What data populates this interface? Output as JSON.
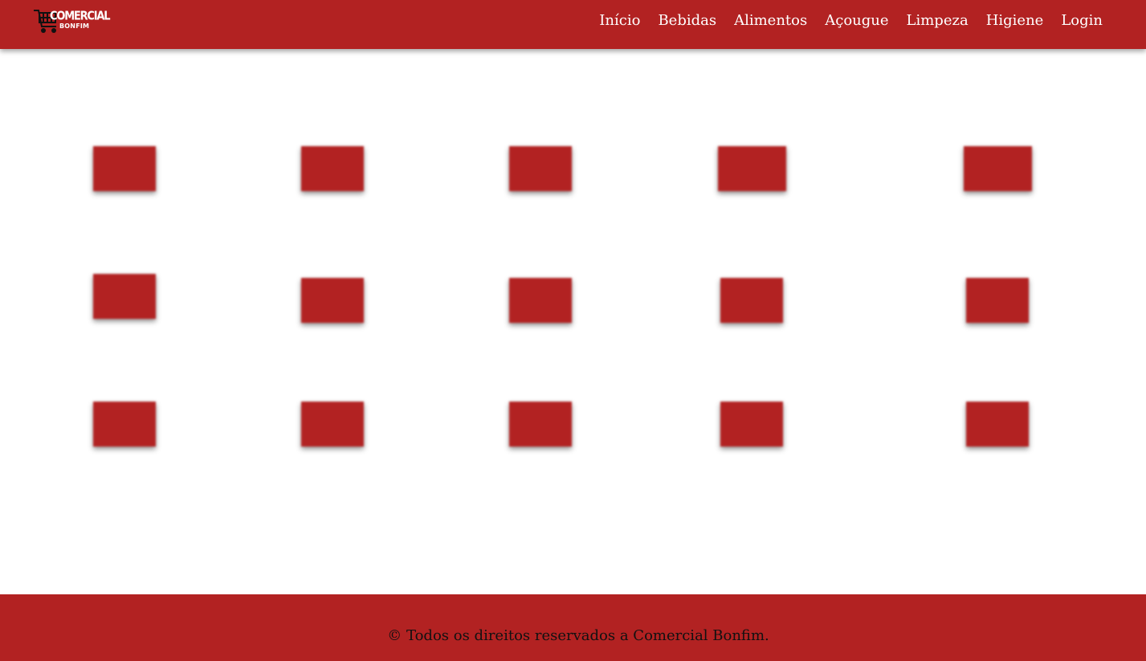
{
  "brand": {
    "line1": "COMERCIAL",
    "line2": "BONFIM",
    "logo_icon": "shopping-cart-icon"
  },
  "nav": {
    "items": [
      {
        "label": "Início"
      },
      {
        "label": "Bebidas"
      },
      {
        "label": "Alimentos"
      },
      {
        "label": "Açougue"
      },
      {
        "label": "Limpeza"
      },
      {
        "label": "Higiene"
      },
      {
        "label": "Login"
      }
    ]
  },
  "footer": {
    "text": "© Todos os direitos reservados a Comercial Bonfim."
  },
  "colors": {
    "primary": "#b22222",
    "background": "#ffffff",
    "footer_text": "#111111"
  }
}
